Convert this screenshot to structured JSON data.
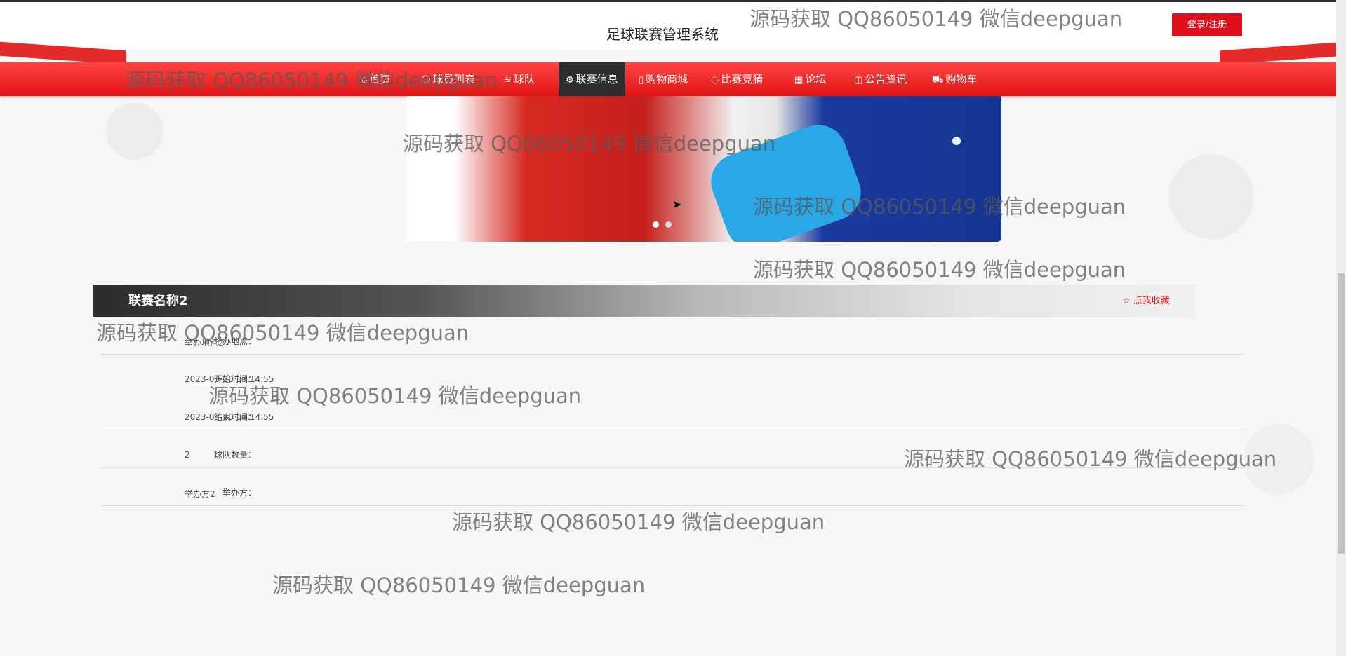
{
  "site": {
    "title": "足球联赛管理系统",
    "login_label": "登录/注册"
  },
  "nav": [
    {
      "label": "首页",
      "icon": "home-icon"
    },
    {
      "label": "球员列表",
      "icon": "user-icon"
    },
    {
      "label": "球队",
      "icon": "layers-icon"
    },
    {
      "label": "联赛信息",
      "icon": "gear-icon"
    },
    {
      "label": "购物商城",
      "icon": "doc-icon"
    },
    {
      "label": "比赛竞猜",
      "icon": "circle-icon"
    },
    {
      "label": "论坛",
      "icon": "building-icon"
    },
    {
      "label": "公告资讯",
      "icon": "megaphone-icon"
    },
    {
      "label": "购物车",
      "icon": "cart-icon"
    }
  ],
  "league": {
    "name": "联赛名称2",
    "favorite_label": "点我收藏",
    "fields": [
      {
        "label": "举办地点：",
        "value": "举办地点2"
      },
      {
        "label": "开始时间：",
        "value": "2023-03-20 13:14:55"
      },
      {
        "label": "结束时间：",
        "value": "2023-03-20 13:14:55"
      },
      {
        "label": "球队数量：",
        "value": "2"
      },
      {
        "label": "举办方：",
        "value": "举办方2"
      }
    ]
  },
  "watermark": "源码获取 QQ86050149 微信deepguan",
  "colors": {
    "accent": "#e00f1c",
    "nav_active": "#2d2d2d"
  }
}
